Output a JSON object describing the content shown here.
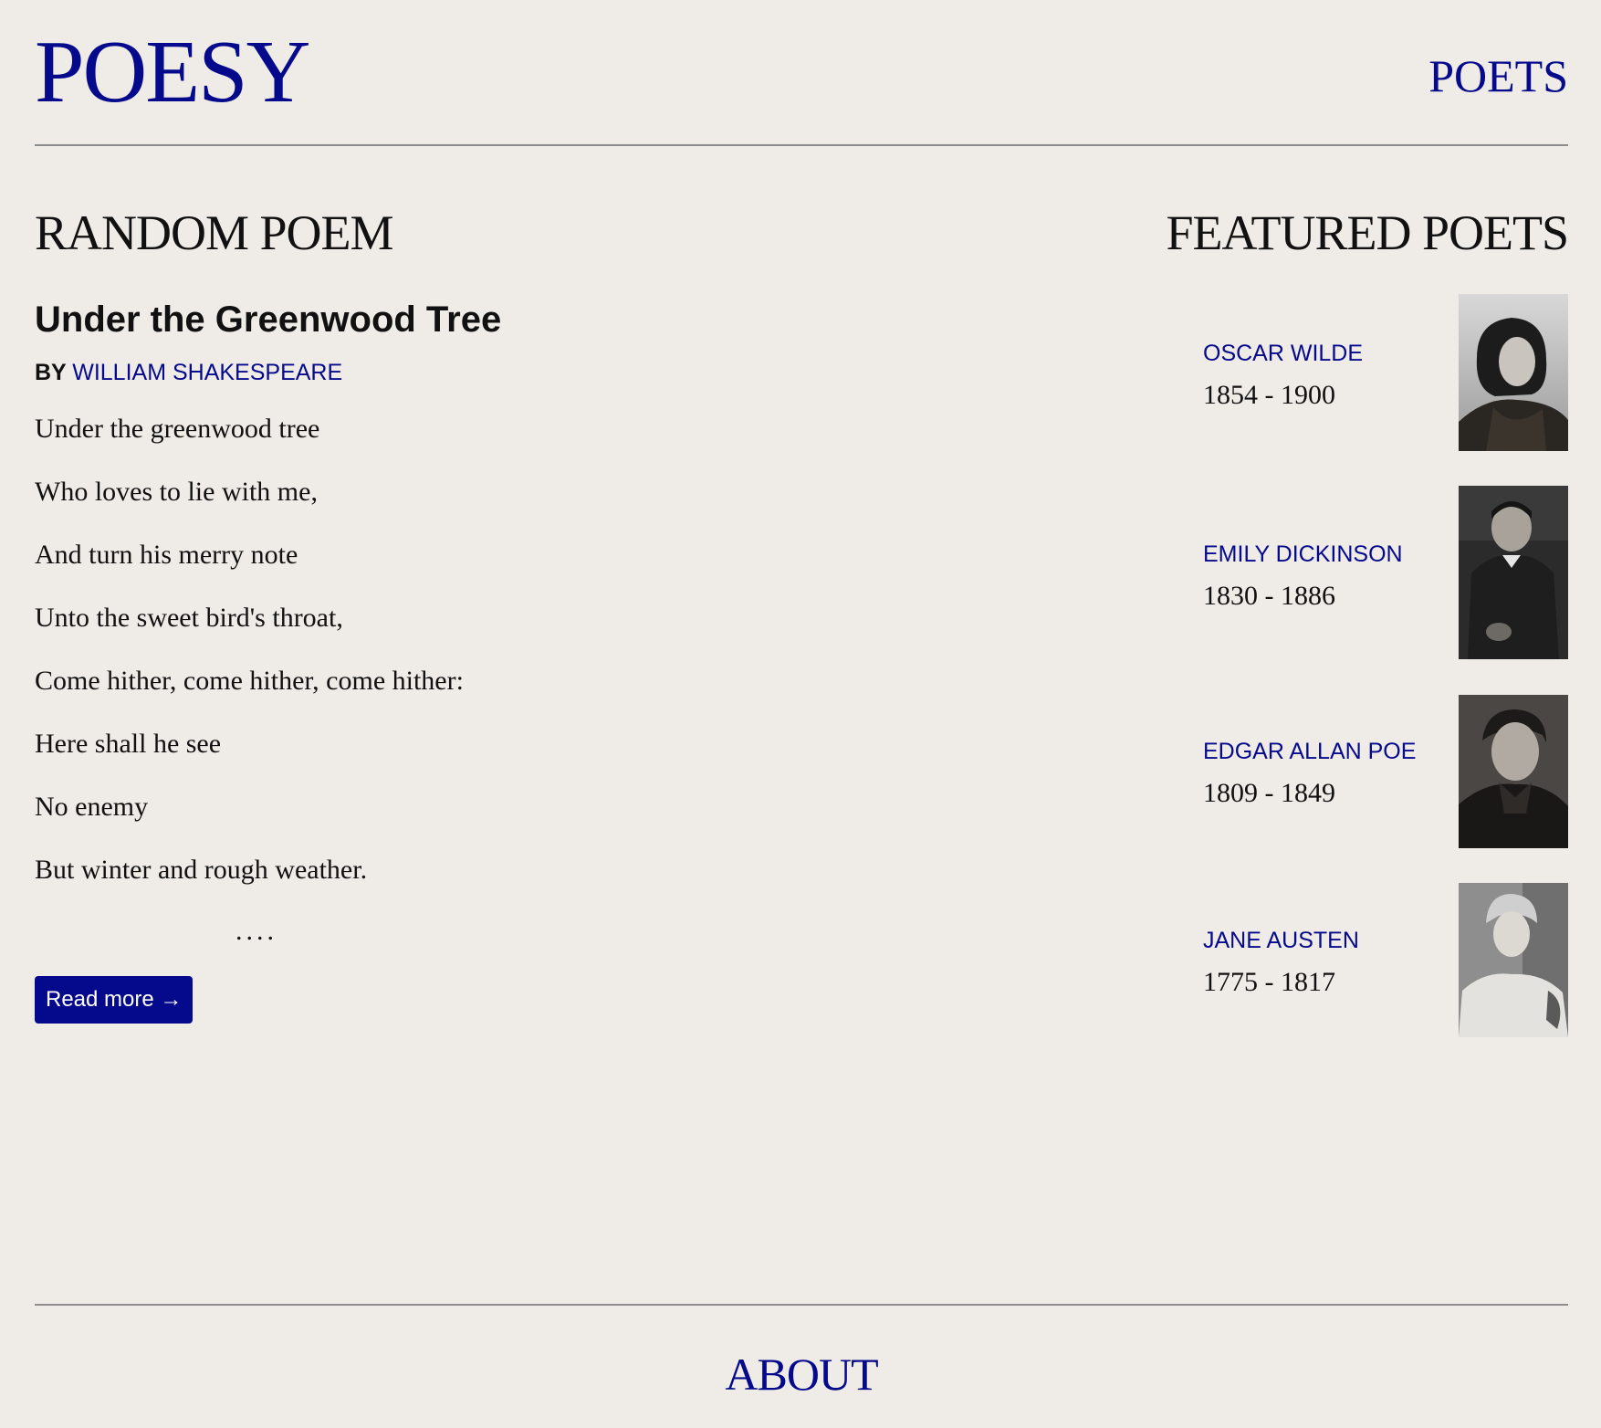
{
  "header": {
    "logo": "POESY",
    "nav_poets": "POETS"
  },
  "random_poem": {
    "heading": "RANDOM POEM",
    "title": "Under the Greenwood Tree",
    "by": "BY",
    "author": "WILLIAM SHAKESPEARE",
    "lines": [
      "Under the greenwood tree",
      "Who loves to lie with me,",
      "And turn his merry note",
      "Unto the sweet bird's throat,",
      "Come hither, come hither, come hither:",
      "Here shall he see",
      "No enemy",
      "But winter and rough weather."
    ],
    "ellipsis": "....",
    "read_more": "Read more →"
  },
  "featured": {
    "heading": "FEATURED POETS",
    "poets": [
      {
        "name": "OSCAR WILDE",
        "years": "1854 - 1900"
      },
      {
        "name": "EMILY DICKINSON",
        "years": "1830 - 1886"
      },
      {
        "name": "EDGAR ALLAN POE",
        "years": "1809 - 1849"
      },
      {
        "name": "JANE AUSTEN",
        "years": "1775 - 1817"
      }
    ]
  },
  "footer": {
    "about": "ABOUT"
  },
  "colors": {
    "background": "#efebe6",
    "accent": "#050a8c",
    "text": "#111111",
    "rule": "#8c8c8c"
  }
}
